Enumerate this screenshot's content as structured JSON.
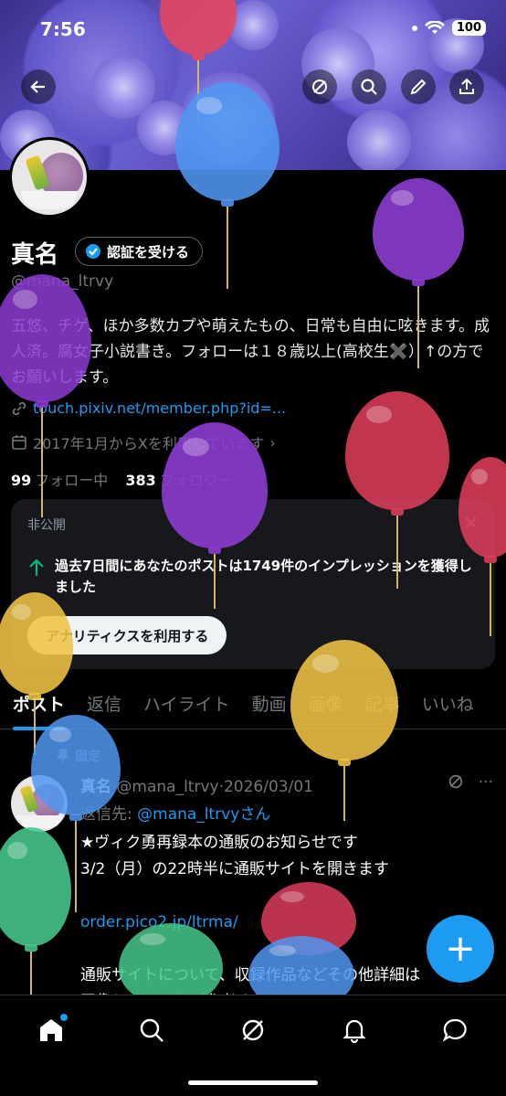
{
  "status_bar": {
    "time": "7:56",
    "battery": "100"
  },
  "profile": {
    "name": "真名",
    "verify_button": "認証を受ける",
    "handle": "@mana_ltrvy",
    "bio": "五悠、チゲ、ほか多数カプや萌えたもの、日常も自由に呟きます。成人済。腐女子小説書き。フォローは１８歳以上(高校生✖️）↑の方でお願いします。",
    "link": "touch.pixiv.net/member.php?id=...",
    "joined": "2017年1月からXを利用しています",
    "following_count": "99",
    "following_label": "フォロー中",
    "followers_count": "383",
    "followers_label": "フォロワー"
  },
  "private_card": {
    "title": "非公開",
    "message": "過去7日間にあなたのポストは1749件のインプレッションを獲得しました",
    "button": "アナリティクスを利用する"
  },
  "tabs": [
    "ポスト",
    "返信",
    "ハイライト",
    "動画",
    "画像",
    "記事",
    "いいね"
  ],
  "post": {
    "pinned_label": "固定",
    "author": "真名",
    "handle": "@mana_ltrvy",
    "date": "2026/03/01",
    "reply_prefix": "返信先: ",
    "reply_handle": "@mana_ltrvy",
    "reply_suffix": "さん",
    "line1": "★ヴィク勇再録本の通販のお知らせです",
    "line2": "3/2（月）の22時半に通販サイトを開きます",
    "link": "order.pico2.jp/ltrma/",
    "line3": "通販サイトについて、収録作品などその他詳細は",
    "line4": "画像とツリーをご参考ください"
  },
  "fab_label": "+",
  "icons": [
    "back-arrow-icon",
    "grok-icon",
    "search-icon",
    "edit-icon",
    "share-icon",
    "verified-icon",
    "link-icon",
    "calendar-icon",
    "arrow-up-icon",
    "pin-icon",
    "home-icon",
    "explore-icon",
    "grok-tab-icon",
    "notifications-icon",
    "messages-icon"
  ],
  "colors": {
    "accent": "#1d9bf0",
    "background": "#000000",
    "card": "#16181c",
    "muted": "#71767b"
  }
}
